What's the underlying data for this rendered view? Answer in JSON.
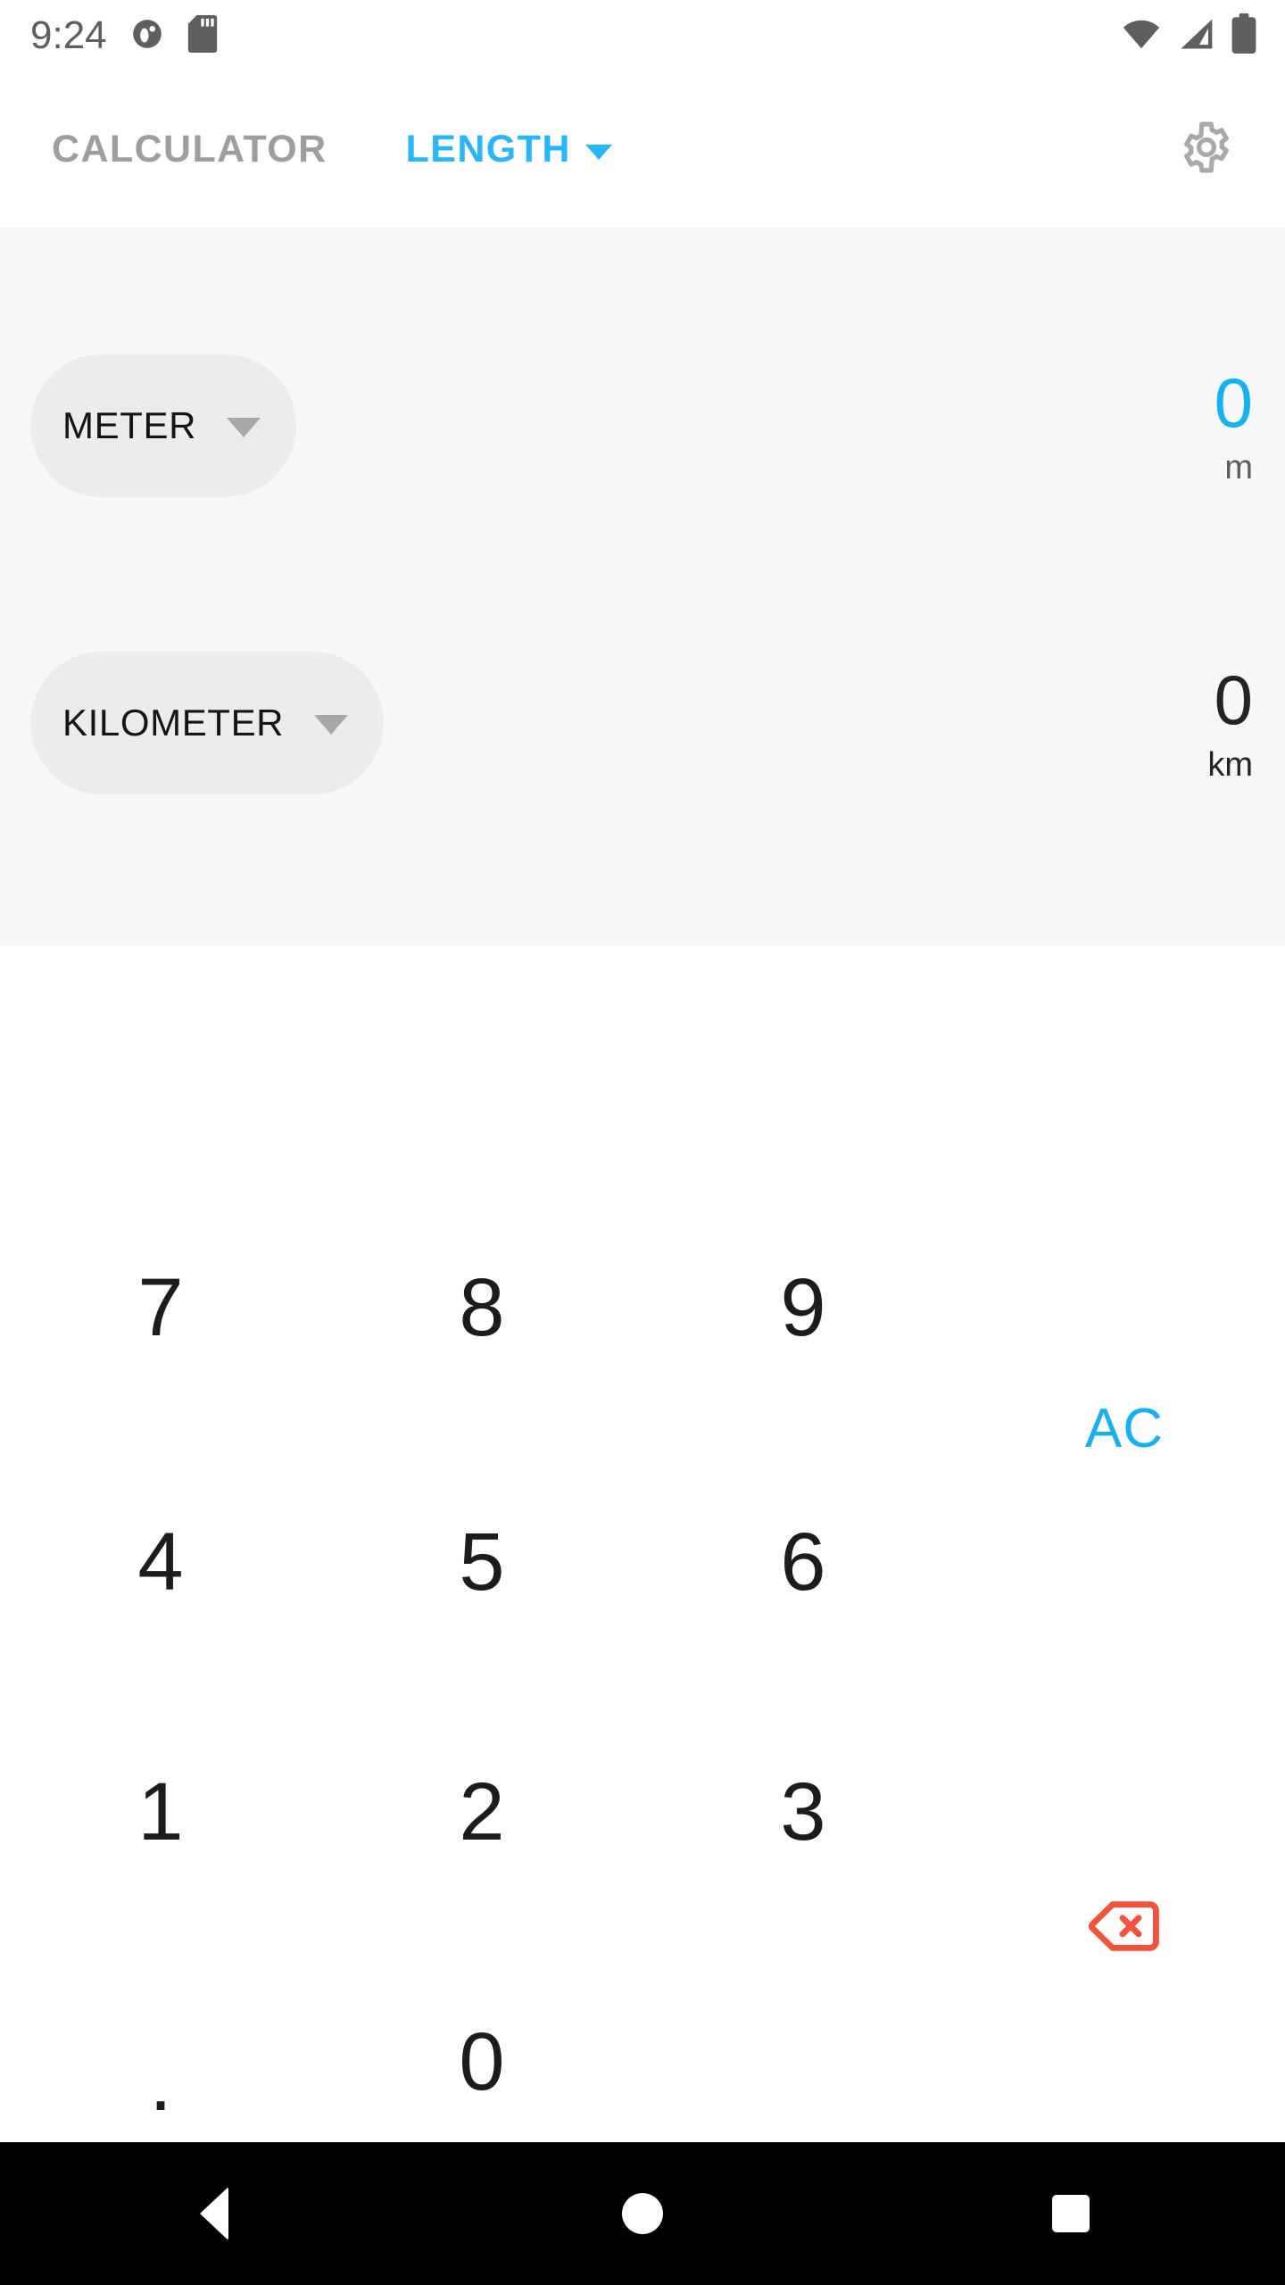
{
  "status_bar": {
    "time": "9:24",
    "left_icons": [
      "app-circle-icon",
      "sd-card-icon"
    ],
    "right_icons": [
      "wifi-icon",
      "cell-signal-icon",
      "battery-icon"
    ],
    "icon_color": "#5f5f5f"
  },
  "app_bar": {
    "app_title": "CALCULATOR",
    "category": "LENGTH",
    "category_caret": "chevron-down-icon",
    "settings_icon": "gear-icon",
    "accent_color": "#29b6f6",
    "title_color": "#9e9e9e"
  },
  "display": {
    "background": "#f7f6f8",
    "rows": [
      {
        "unit_label": "METER",
        "unit_caret": "chevron-down-icon",
        "value": "0",
        "unit_symbol": "m",
        "active": true,
        "value_color": "#17b1f0"
      },
      {
        "unit_label": "KILOMETER",
        "unit_caret": "chevron-down-icon",
        "value": "0",
        "unit_symbol": "km",
        "active": false,
        "value_color": "#242424"
      }
    ]
  },
  "keypad": {
    "keys": {
      "seven": "7",
      "eight": "8",
      "nine": "9",
      "four": "4",
      "five": "5",
      "six": "6",
      "one": "1",
      "two": "2",
      "three": "3",
      "dot": ".",
      "zero": "0",
      "all_clear": "AC",
      "backspace_icon": "backspace-icon"
    },
    "all_clear_color": "#17b1f0",
    "backspace_color": "#f2533c",
    "digit_color": "#1c1c1c"
  },
  "nav_bar": {
    "background": "#000000",
    "back": "back-triangle-icon",
    "home": "home-circle-icon",
    "recents": "recents-square-icon"
  }
}
